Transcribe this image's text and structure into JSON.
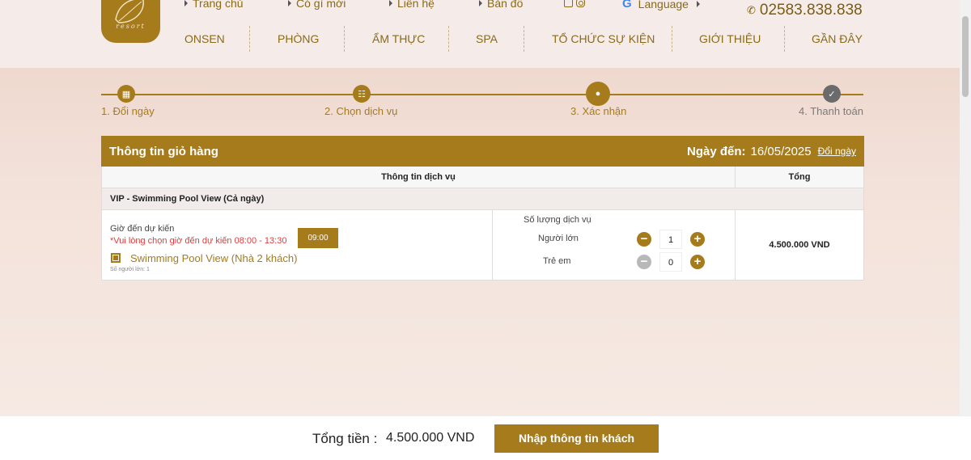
{
  "header": {
    "logo_text": "resort",
    "top_links": [
      "Trang chủ",
      "Có gì mới",
      "Liên hệ",
      "Bản đồ"
    ],
    "language_label": "Language",
    "phone": "02583.838.838",
    "nav": [
      "ONSEN",
      "PHÒNG",
      "ẨM THỰC",
      "SPA",
      "TỔ CHỨC SỰ KIỆN",
      "GIỚI THIỆU",
      "GẦN ĐÂY"
    ]
  },
  "steps": [
    {
      "label": "1. Đổi ngày",
      "icon": "calendar-icon",
      "status": "done"
    },
    {
      "label": "2. Chọn dịch vụ",
      "icon": "cart-icon",
      "status": "done"
    },
    {
      "label": "3. Xác nhận",
      "icon": "user-icon",
      "status": "current"
    },
    {
      "label": "4. Thanh toán",
      "icon": "check-icon",
      "status": "pending"
    }
  ],
  "cart": {
    "title": "Thông tin giỏ hàng",
    "arrival_label": "Ngày đến:",
    "arrival_date": "16/05/2025",
    "change_date": "Đổi ngày",
    "col_service": "Thông tin dịch vụ",
    "col_total": "Tổng",
    "package_name": "VIP - Swimming Pool View (Cả ngày)",
    "arrival_time_label": "Giờ đến dự kiến",
    "arrival_time_warning": "*Vui lòng chọn giờ đến dự kiến 08:00 - 13:30",
    "arrival_time": "09:00",
    "room_name": "Swimming Pool View (Nhà 2 khách)",
    "guest_note": "Số người lớn: 1",
    "qty_header": "Số lượng dịch vụ",
    "adults_label": "Người lớn",
    "adults_qty": "1",
    "children_label": "Trẻ em",
    "children_qty": "0",
    "line_total": "4.500.000 VND"
  },
  "footer": {
    "total_label": "Tổng tiền :",
    "total_value": "4.500.000 VND",
    "cta": "Nhập thông tin khách"
  },
  "colors": {
    "brand": "#a67b1b",
    "warning": "#e03c3c"
  }
}
